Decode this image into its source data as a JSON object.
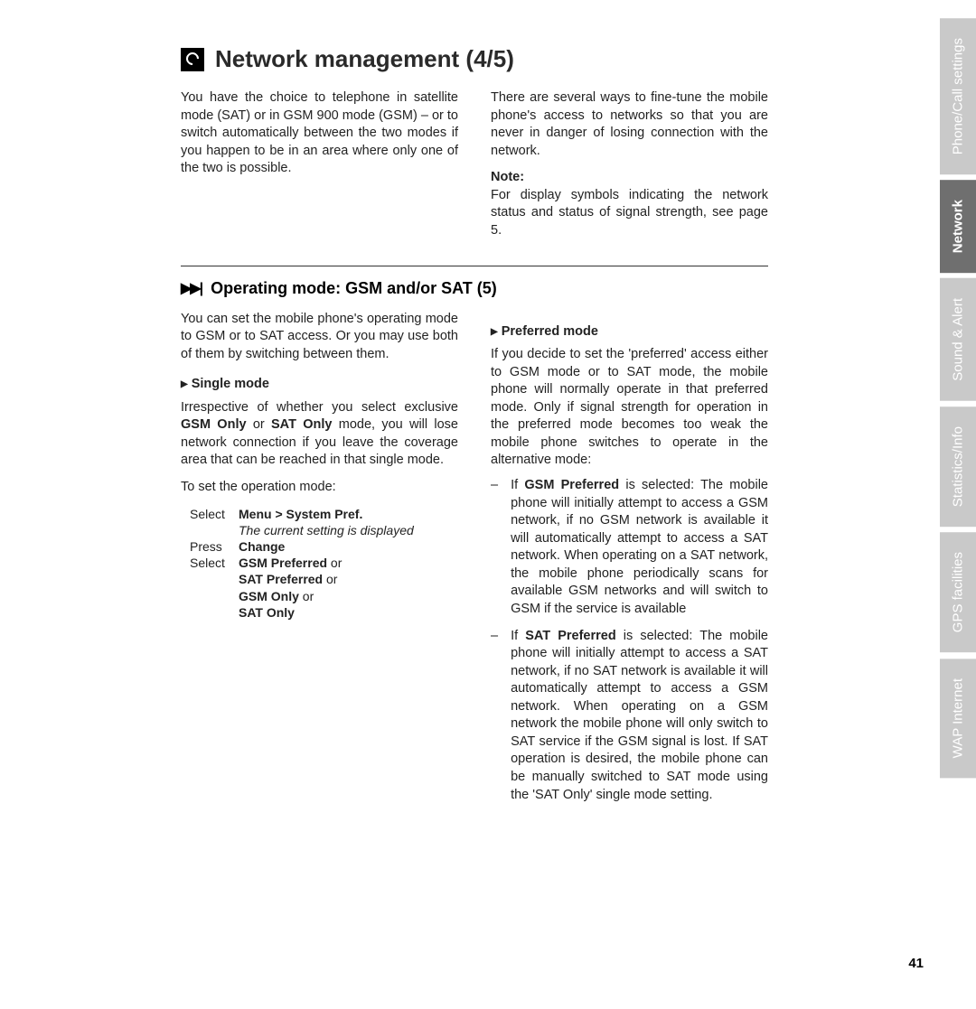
{
  "header": {
    "title": "Network management (4/5)"
  },
  "intro": {
    "left": "You have the choice to telephone in satellite mode (SAT) or in GSM 900 mode (GSM) – or to switch automatically between the two modes if you happen to be in an area where only one of the two is possible.",
    "right": "There are several ways to fine-tune the mobile phone's access to networks so that you are never in danger of losing connection with the network.",
    "note_label": "Note:",
    "note_text": "For display symbols indicating the network status and status of signal strength, see page 5."
  },
  "section": {
    "title": "Operating mode: GSM and/or SAT (5)",
    "intro": "You can set the mobile phone's operating mode to GSM or to SAT access. Or you may use both of them by switching between them.",
    "single": {
      "heading": "Single mode",
      "p1a": "Irrespective of whether you select exclusive ",
      "p1b": "GSM Only",
      "p1c": " or ",
      "p1d": "SAT Only",
      "p1e": " mode, you will lose network connection if you leave the coverage area that can be reached in that single mode.",
      "p2": "To set the operation mode:",
      "steps": [
        {
          "a": "Select",
          "b": "Menu > System Pref.",
          "bold": true
        },
        {
          "a": "",
          "b": "The current setting is displayed",
          "ital": true
        },
        {
          "a": "Press",
          "b": "Change",
          "bold": true
        },
        {
          "a": "Select",
          "b_html": "<strong>GSM Preferred</strong> or"
        },
        {
          "a": "",
          "b_html": "<strong>SAT Preferred</strong> or"
        },
        {
          "a": "",
          "b_html": "<strong>GSM Only</strong> or"
        },
        {
          "a": "",
          "b_html": "<strong>SAT Only</strong>"
        }
      ]
    },
    "preferred": {
      "heading": "Preferred mode",
      "intro": "If you decide to set the 'preferred' access either to GSM mode or to SAT mode, the mobile phone will normally operate in that preferred mode. Only if signal strength for operation in the preferred mode becomes too weak the mobile phone switches to operate in the alternative mode:",
      "items": [
        {
          "lead": "GSM Preferred",
          "text_a": "If ",
          "text_b": " is selected: The mobile phone will initially attempt to access a GSM network, if no GSM network is available it will automatically attempt to access a SAT network.  When operating on a SAT network, the mobile phone periodically scans for available GSM networks and will switch to GSM if the service is available"
        },
        {
          "lead": "SAT Preferred",
          "text_a": "If ",
          "text_b": " is selected: The mobile phone will initially attempt to access a SAT network, if no SAT network is available it will automatically attempt to access a GSM network.  When operating on a GSM network the mobile phone will only switch to SAT service if the GSM signal is lost.  If SAT operation is desired, the mobile phone can be manually switched to SAT mode using the 'SAT Only' single mode setting."
        }
      ]
    }
  },
  "tabs": [
    {
      "label": "Phone/Call settings",
      "active": false
    },
    {
      "label": "Network",
      "active": true
    },
    {
      "label": "Sound & Alert",
      "active": false
    },
    {
      "label": "Statistics/Info",
      "active": false
    },
    {
      "label": "GPS facilities",
      "active": false
    },
    {
      "label": "WAP Internet",
      "active": false
    }
  ],
  "page_number": "41"
}
